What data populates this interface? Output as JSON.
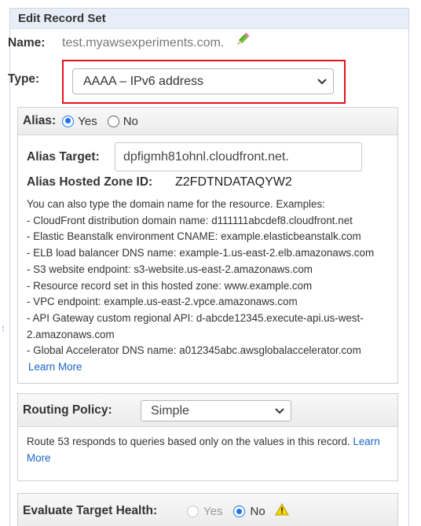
{
  "panel": {
    "title": "Edit Record Set"
  },
  "name": {
    "label": "Name:",
    "value": "test.myawsexperiments.com.",
    "edit_icon": "pencil-icon"
  },
  "type": {
    "label": "Type:",
    "selected": "AAAA – IPv6 address",
    "highlight_color": "#e3141c"
  },
  "alias": {
    "label": "Alias:",
    "yes_label": "Yes",
    "no_label": "No",
    "selected": "Yes",
    "target_label": "Alias Target:",
    "target_value": "dpfigmh81ohnl.cloudfront.net.",
    "hosted_zone_label": "Alias Hosted Zone ID:",
    "hosted_zone_value": "Z2FDTNDATAQYW2",
    "help_intro": "You can also type the domain name for the resource. Examples:",
    "examples": [
      "-  CloudFront distribution domain name: d111111abcdef8.cloudfront.net",
      "-  Elastic Beanstalk environment CNAME: example.elasticbeanstalk.com",
      "-  ELB load balancer DNS name: example-1.us-east-2.elb.amazonaws.com",
      "-  S3 website endpoint: s3-website.us-east-2.amazonaws.com",
      "-  Resource record set in this hosted zone: www.example.com",
      "-  VPC endpoint: example.us-east-2.vpce.amazonaws.com",
      "-  API Gateway custom regional API: d-abcde12345.execute-api.us-west-2.amazonaws.com",
      "-  Global Accelerator DNS name: a012345abc.awsglobalaccelerator.com"
    ],
    "learn_more": "Learn More"
  },
  "routing": {
    "label": "Routing Policy:",
    "selected": "Simple",
    "description": "Route 53 responds to queries based only on the values in this record.",
    "learn_more": "Learn More"
  },
  "evaluate": {
    "label": "Evaluate Target Health:",
    "yes_label": "Yes",
    "no_label": "No",
    "selected": "No",
    "warning_icon": "warning-icon"
  },
  "colors": {
    "link": "#1a64c8",
    "radio_selected": "#1a73e8",
    "header_bg": "#e8eef7"
  }
}
